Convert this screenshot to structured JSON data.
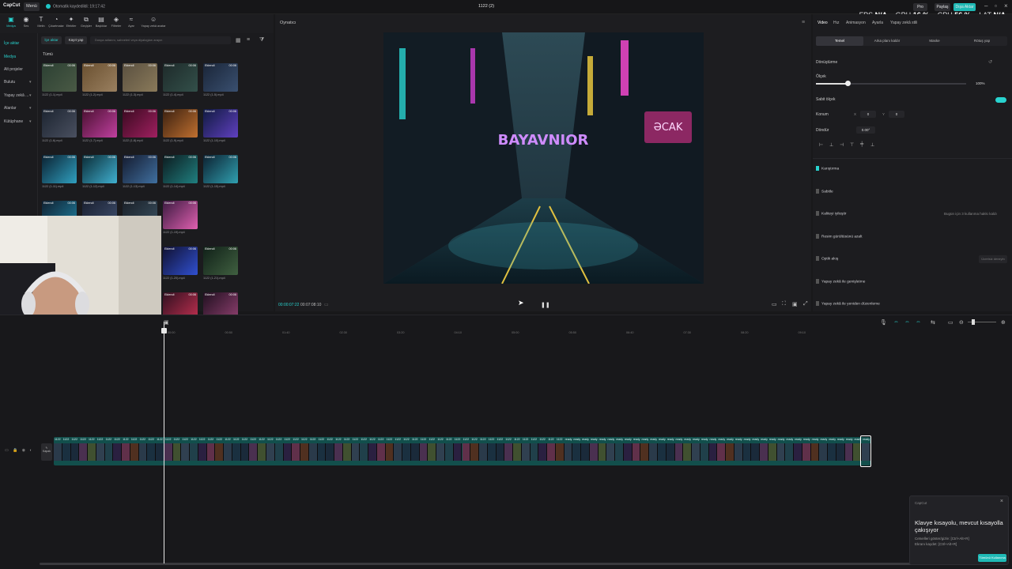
{
  "topbar": {
    "logo": "CapCut",
    "menu": "Menü",
    "autosave": "Otomatik kaydedildi: 19:17:42",
    "project_title": "1122 (2)",
    "pro": "Pro",
    "share": "Paylaş",
    "export": "Dışa Aktar",
    "stats": {
      "fps_label": "FPS",
      "fps": "N/A",
      "gpu_label": "GPU",
      "gpu": "16 %",
      "cpu_label": "CPU",
      "cpu": "56 %",
      "lat_label": "LAT",
      "lat": "N/A"
    }
  },
  "tools": [
    "Medya",
    "Ses",
    "Metin",
    "Çıkartmalar",
    "Efektler",
    "Geçişler",
    "Başlıklar",
    "Filtreler",
    "Ayar",
    "Yapay zekâ avatar"
  ],
  "leftnav": [
    {
      "label": "İçe aktar",
      "chev": false,
      "active": true
    },
    {
      "label": "Medya",
      "chev": false,
      "active": true
    },
    {
      "label": "Alt projeler",
      "chev": false,
      "active": false
    },
    {
      "label": "Bulutu",
      "chev": true,
      "active": false
    },
    {
      "label": "Yapay zekâ ...",
      "chev": true,
      "active": false
    },
    {
      "label": "Alanlar",
      "chev": true,
      "active": false
    },
    {
      "label": "Kütüphane",
      "chev": true,
      "active": false
    }
  ],
  "media": {
    "import": "İçe aktar",
    "record": "Kayıt yap",
    "search_placeholder": "Dosya adlarını, sahneleri veya diyalogları arayın",
    "filter_all": "Tümü",
    "items": [
      {
        "name": "1122 (1-1).mp4",
        "tag": "Eklendi",
        "dur": "00:06"
      },
      {
        "name": "1122 (1-2).mp4",
        "tag": "Eklendi",
        "dur": "00:06"
      },
      {
        "name": "1122 (1-3).mp4",
        "tag": "Eklendi",
        "dur": "00:06"
      },
      {
        "name": "1122 (1-4).mp4",
        "tag": "Eklendi",
        "dur": "00:06"
      },
      {
        "name": "1122 (1-5).mp4",
        "tag": "Eklendi",
        "dur": "00:06"
      },
      {
        "name": "1122 (1-6).mp4",
        "tag": "Eklendi",
        "dur": "00:06"
      },
      {
        "name": "1122 (1-7).mp4",
        "tag": "Eklendi",
        "dur": "00:06"
      },
      {
        "name": "1122 (1-8).mp4",
        "tag": "Eklendi",
        "dur": "00:06"
      },
      {
        "name": "1122 (1-9).mp4",
        "tag": "Eklendi",
        "dur": "00:06"
      },
      {
        "name": "1122 (1-10).mp4",
        "tag": "Eklendi",
        "dur": "00:06"
      },
      {
        "name": "1122 (1-11).mp4",
        "tag": "Eklendi",
        "dur": "00:06"
      },
      {
        "name": "1122 (1-12).mp4",
        "tag": "Eklendi",
        "dur": "00:06"
      },
      {
        "name": "1122 (1-13).mp4",
        "tag": "Eklendi",
        "dur": "00:06"
      },
      {
        "name": "1122 (1-14).mp4",
        "tag": "Eklendi",
        "dur": "00:06"
      },
      {
        "name": "1122 (1-15).mp4",
        "tag": "Eklendi",
        "dur": "00:06"
      },
      {
        "name": "1122 (1-16).mp4",
        "tag": "Eklendi",
        "dur": "00:06"
      },
      {
        "name": "1122 (1-17).mp4",
        "tag": "Eklendi",
        "dur": "00:06"
      },
      {
        "name": "1122 (1-18).mp4",
        "tag": "Eklendi",
        "dur": "00:06"
      },
      {
        "name": "1122 (1-19).mp4",
        "tag": "Eklendi",
        "dur": "00:06"
      },
      {
        "name": "1122 (1-20).mp4",
        "tag": "Eklendi",
        "dur": "00:06"
      },
      {
        "name": "1122 (1-21).mp4",
        "tag": "Eklendi",
        "dur": "00:06"
      },
      {
        "name": "1122 (1-22).mp4",
        "tag": "Eklendi",
        "dur": "00:06"
      },
      {
        "name": "1122 (1-23).mp4",
        "tag": "Eklendi",
        "dur": "00:06"
      }
    ]
  },
  "player": {
    "title": "Oynatıcı",
    "current_time": "00:00:07:22",
    "total_time": "00:07:08:10",
    "video_sign": "BAYAVNIOR",
    "video_side_sign": "ƏCAK"
  },
  "inspector": {
    "tabs": [
      "Video",
      "Hız",
      "Animasyon",
      "Ayarla",
      "Yapay zekâ stili"
    ],
    "subtabs": [
      "Temel",
      "Arka planı kaldır",
      "Maske",
      "Rötuş yap"
    ],
    "transform": "Dönüştürme",
    "scale": "Ölçek",
    "scale_value": "100%",
    "uniform_scale": "Sabit ölçek",
    "position": "Konum",
    "pos_x_label": "X",
    "pos_x": "0",
    "pos_y_label": "Y",
    "pos_y": "0",
    "rotate": "Döndür",
    "rotate_value": "0.00°",
    "sections": [
      {
        "label": "Karıştırma"
      },
      {
        "label": "Sabitle"
      },
      {
        "label": "Kaliteyi iyileştir"
      },
      {
        "label": "Resim gürültüsünü azalt"
      },
      {
        "label": "Optik akış"
      },
      {
        "label": "Yapay zekâ ile genişletme"
      },
      {
        "label": "Yapay zekâ ile yeniden düzenleme"
      }
    ],
    "quality_note": "Bugün için 3 kullanma hakkı kaldı",
    "optical_btn": "Ücretsiz deneyin"
  },
  "timeline": {
    "ruler": [
      "00:00",
      "00:50",
      "01:40",
      "02:30",
      "03:20",
      "04:10",
      "05:00",
      "05:50",
      "06:40",
      "07:30",
      "08:20",
      "09:10"
    ],
    "cover_label": "Kapak",
    "clip_labels": [
      "1122",
      "ready"
    ]
  },
  "toast": {
    "app": "CapCut",
    "title": "Klavye kısayolu, mevcut kısayolla çakışıyor",
    "line1": "Cetvelleri göster/gizle: [Ctrl+Alt+R]",
    "line2": "Ekranı kaydet: [Ctrl+Alt+R]",
    "button": "Tümünü Kullanıma"
  },
  "colors": {
    "accent": "#29d3cf",
    "track": "#124f4c"
  }
}
